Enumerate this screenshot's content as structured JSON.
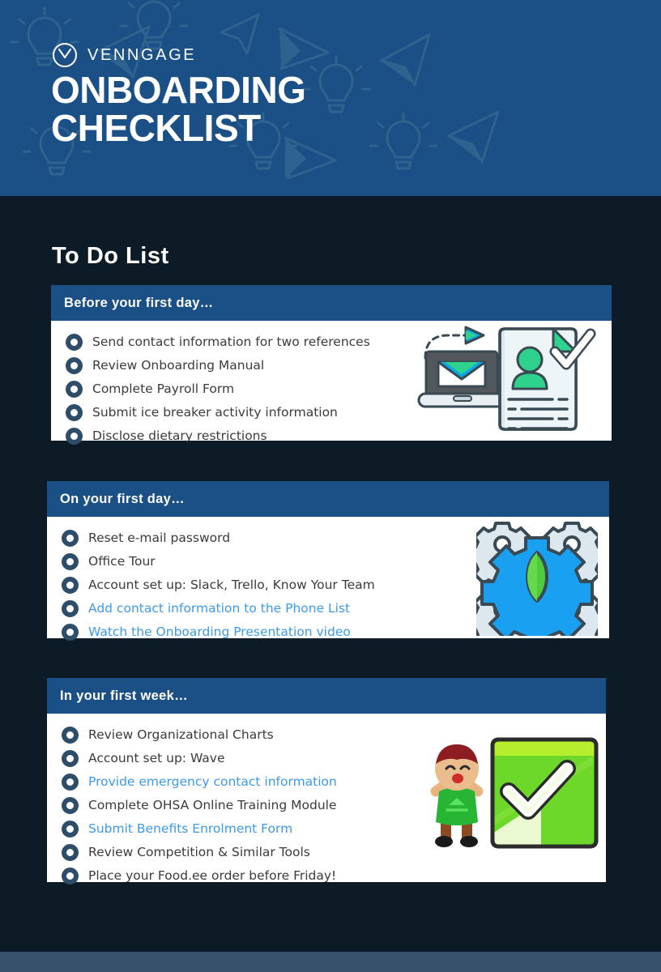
{
  "banner": {
    "logo_icon": "venngage-circle-logo-icon",
    "logo_text": "VENNGAGE",
    "title_line1": "ONBOARDING",
    "title_line2": "CHECKLIST",
    "background_color": "#1b5087",
    "pattern_icons": [
      "lightbulb-icon",
      "paper-plane-icon"
    ]
  },
  "page": {
    "background_color": "#0d1b26",
    "footer_strip_color": "#37506b",
    "section_title": "To Do List",
    "link_color": "#3d9ae8",
    "bullet_color": "#2d4d68",
    "card_background": "#ffffff"
  },
  "groups": [
    {
      "header": "Before your first day…",
      "illustration": "laptop-email-resume-check-illustration",
      "items": [
        {
          "label": "Send contact information for two references",
          "link": false
        },
        {
          "label": "Review Onboarding Manual",
          "link": false
        },
        {
          "label": "Complete Payroll Form",
          "link": false
        },
        {
          "label": "Submit ice breaker activity information",
          "link": false
        },
        {
          "label": "Disclose dietary restrictions",
          "link": false
        }
      ]
    },
    {
      "header": "On your first day…",
      "illustration": "gears-settings-illustration",
      "items": [
        {
          "label": "Reset e-mail password",
          "link": false
        },
        {
          "label": "Office Tour",
          "link": false
        },
        {
          "label": "Account set up: Slack, Trello, Know Your Team",
          "link": false
        },
        {
          "label": "Add contact information to the Phone List",
          "link": true
        },
        {
          "label": "Watch the Onboarding Presentation video",
          "link": true
        }
      ]
    },
    {
      "header": "In your first week…",
      "illustration": "celebrating-person-green-checkmark-illustration",
      "items": [
        {
          "label": "Review Organizational Charts",
          "link": false
        },
        {
          "label": "Account set up: Wave",
          "link": false
        },
        {
          "label": "Provide emergency contact information",
          "link": true
        },
        {
          "label": "Complete OHSA Online Training Module",
          "link": false
        },
        {
          "label": "Submit Benefits Enrolment Form",
          "link": true
        },
        {
          "label": "Review Competition & Similar Tools",
          "link": false
        },
        {
          "label": "Place your Food.ee order before Friday!",
          "link": false
        }
      ]
    }
  ]
}
